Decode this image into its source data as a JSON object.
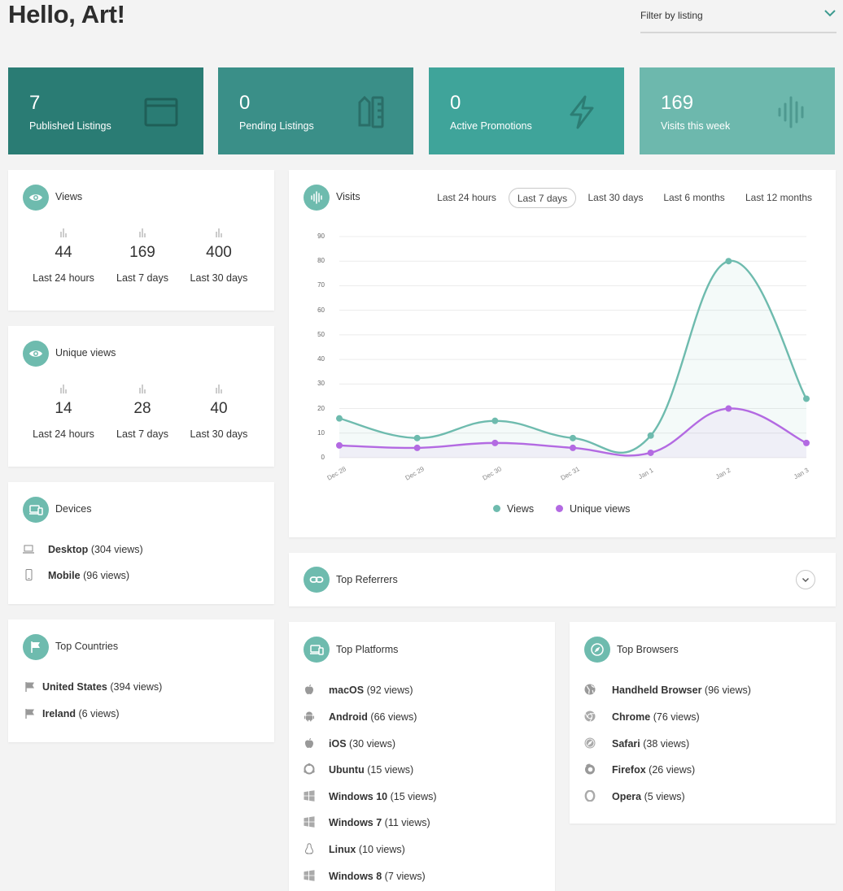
{
  "header": {
    "greeting": "Hello, Art!",
    "filter_label": "Filter by listing",
    "accent_color": "#3c9a8f"
  },
  "stats": [
    {
      "value": "7",
      "label": "Published Listings",
      "color": "#2a7c74",
      "icon": "browser-window-icon"
    },
    {
      "value": "0",
      "label": "Pending Listings",
      "color": "#3a8f88",
      "icon": "pencil-ruler-icon"
    },
    {
      "value": "0",
      "label": "Active Promotions",
      "color": "#3fa49a",
      "icon": "lightning-icon"
    },
    {
      "value": "169",
      "label": "Visits this week",
      "color": "#6db8ad",
      "icon": "soundwave-icon"
    }
  ],
  "views": {
    "title": "Views",
    "metrics": [
      {
        "value": "44",
        "label": "Last 24 hours"
      },
      {
        "value": "169",
        "label": "Last 7 days"
      },
      {
        "value": "400",
        "label": "Last 30 days"
      }
    ]
  },
  "unique_views": {
    "title": "Unique views",
    "metrics": [
      {
        "value": "14",
        "label": "Last 24 hours"
      },
      {
        "value": "28",
        "label": "Last 7 days"
      },
      {
        "value": "40",
        "label": "Last 30 days"
      }
    ]
  },
  "devices": {
    "title": "Devices",
    "items": [
      {
        "name": "Desktop",
        "count": "(304 views)",
        "icon": "laptop-icon"
      },
      {
        "name": "Mobile",
        "count": "(96 views)",
        "icon": "mobile-icon"
      }
    ]
  },
  "countries": {
    "title": "Top Countries",
    "items": [
      {
        "name": "United States",
        "count": "(394 views)",
        "icon": "flag-icon"
      },
      {
        "name": "Ireland",
        "count": "(6 views)",
        "icon": "flag-icon"
      }
    ]
  },
  "visits": {
    "title": "Visits",
    "ranges": [
      "Last 24 hours",
      "Last 7 days",
      "Last 30 days",
      "Last 6 months",
      "Last 12 months"
    ],
    "active_range": "Last 7 days"
  },
  "chart_data": {
    "type": "area",
    "x": [
      "Dec 28",
      "Dec 29",
      "Dec 30",
      "Dec 31",
      "Jan 1",
      "Jan 2",
      "Jan 3"
    ],
    "series": [
      {
        "name": "Views",
        "color": "#6ebbae",
        "values": [
          16,
          8,
          15,
          8,
          9,
          80,
          24
        ]
      },
      {
        "name": "Unique views",
        "color": "#b36ae2",
        "values": [
          5,
          4,
          6,
          4,
          2,
          20,
          6
        ]
      }
    ],
    "ylim": [
      0,
      90
    ],
    "yticks": [
      0,
      10,
      20,
      30,
      40,
      50,
      60,
      70,
      80,
      90
    ],
    "grid": true,
    "legend_position": "bottom"
  },
  "referrers": {
    "title": "Top Referrers"
  },
  "platforms": {
    "title": "Top Platforms",
    "items": [
      {
        "name": "macOS",
        "count": "(92 views)",
        "icon": "apple-icon"
      },
      {
        "name": "Android",
        "count": "(66 views)",
        "icon": "android-icon"
      },
      {
        "name": "iOS",
        "count": "(30 views)",
        "icon": "apple-icon"
      },
      {
        "name": "Ubuntu",
        "count": "(15 views)",
        "icon": "ubuntu-icon"
      },
      {
        "name": "Windows 10",
        "count": "(15 views)",
        "icon": "windows-icon"
      },
      {
        "name": "Windows 7",
        "count": "(11 views)",
        "icon": "windows-icon"
      },
      {
        "name": "Linux",
        "count": "(10 views)",
        "icon": "linux-icon"
      },
      {
        "name": "Windows 8",
        "count": "(7 views)",
        "icon": "windows-icon"
      }
    ]
  },
  "browsers": {
    "title": "Top Browsers",
    "items": [
      {
        "name": "Handheld Browser",
        "count": "(96 views)",
        "icon": "globe-icon"
      },
      {
        "name": "Chrome",
        "count": "(76 views)",
        "icon": "chrome-icon"
      },
      {
        "name": "Safari",
        "count": "(38 views)",
        "icon": "safari-icon"
      },
      {
        "name": "Firefox",
        "count": "(26 views)",
        "icon": "firefox-icon"
      },
      {
        "name": "Opera",
        "count": "(5 views)",
        "icon": "opera-icon"
      }
    ]
  }
}
